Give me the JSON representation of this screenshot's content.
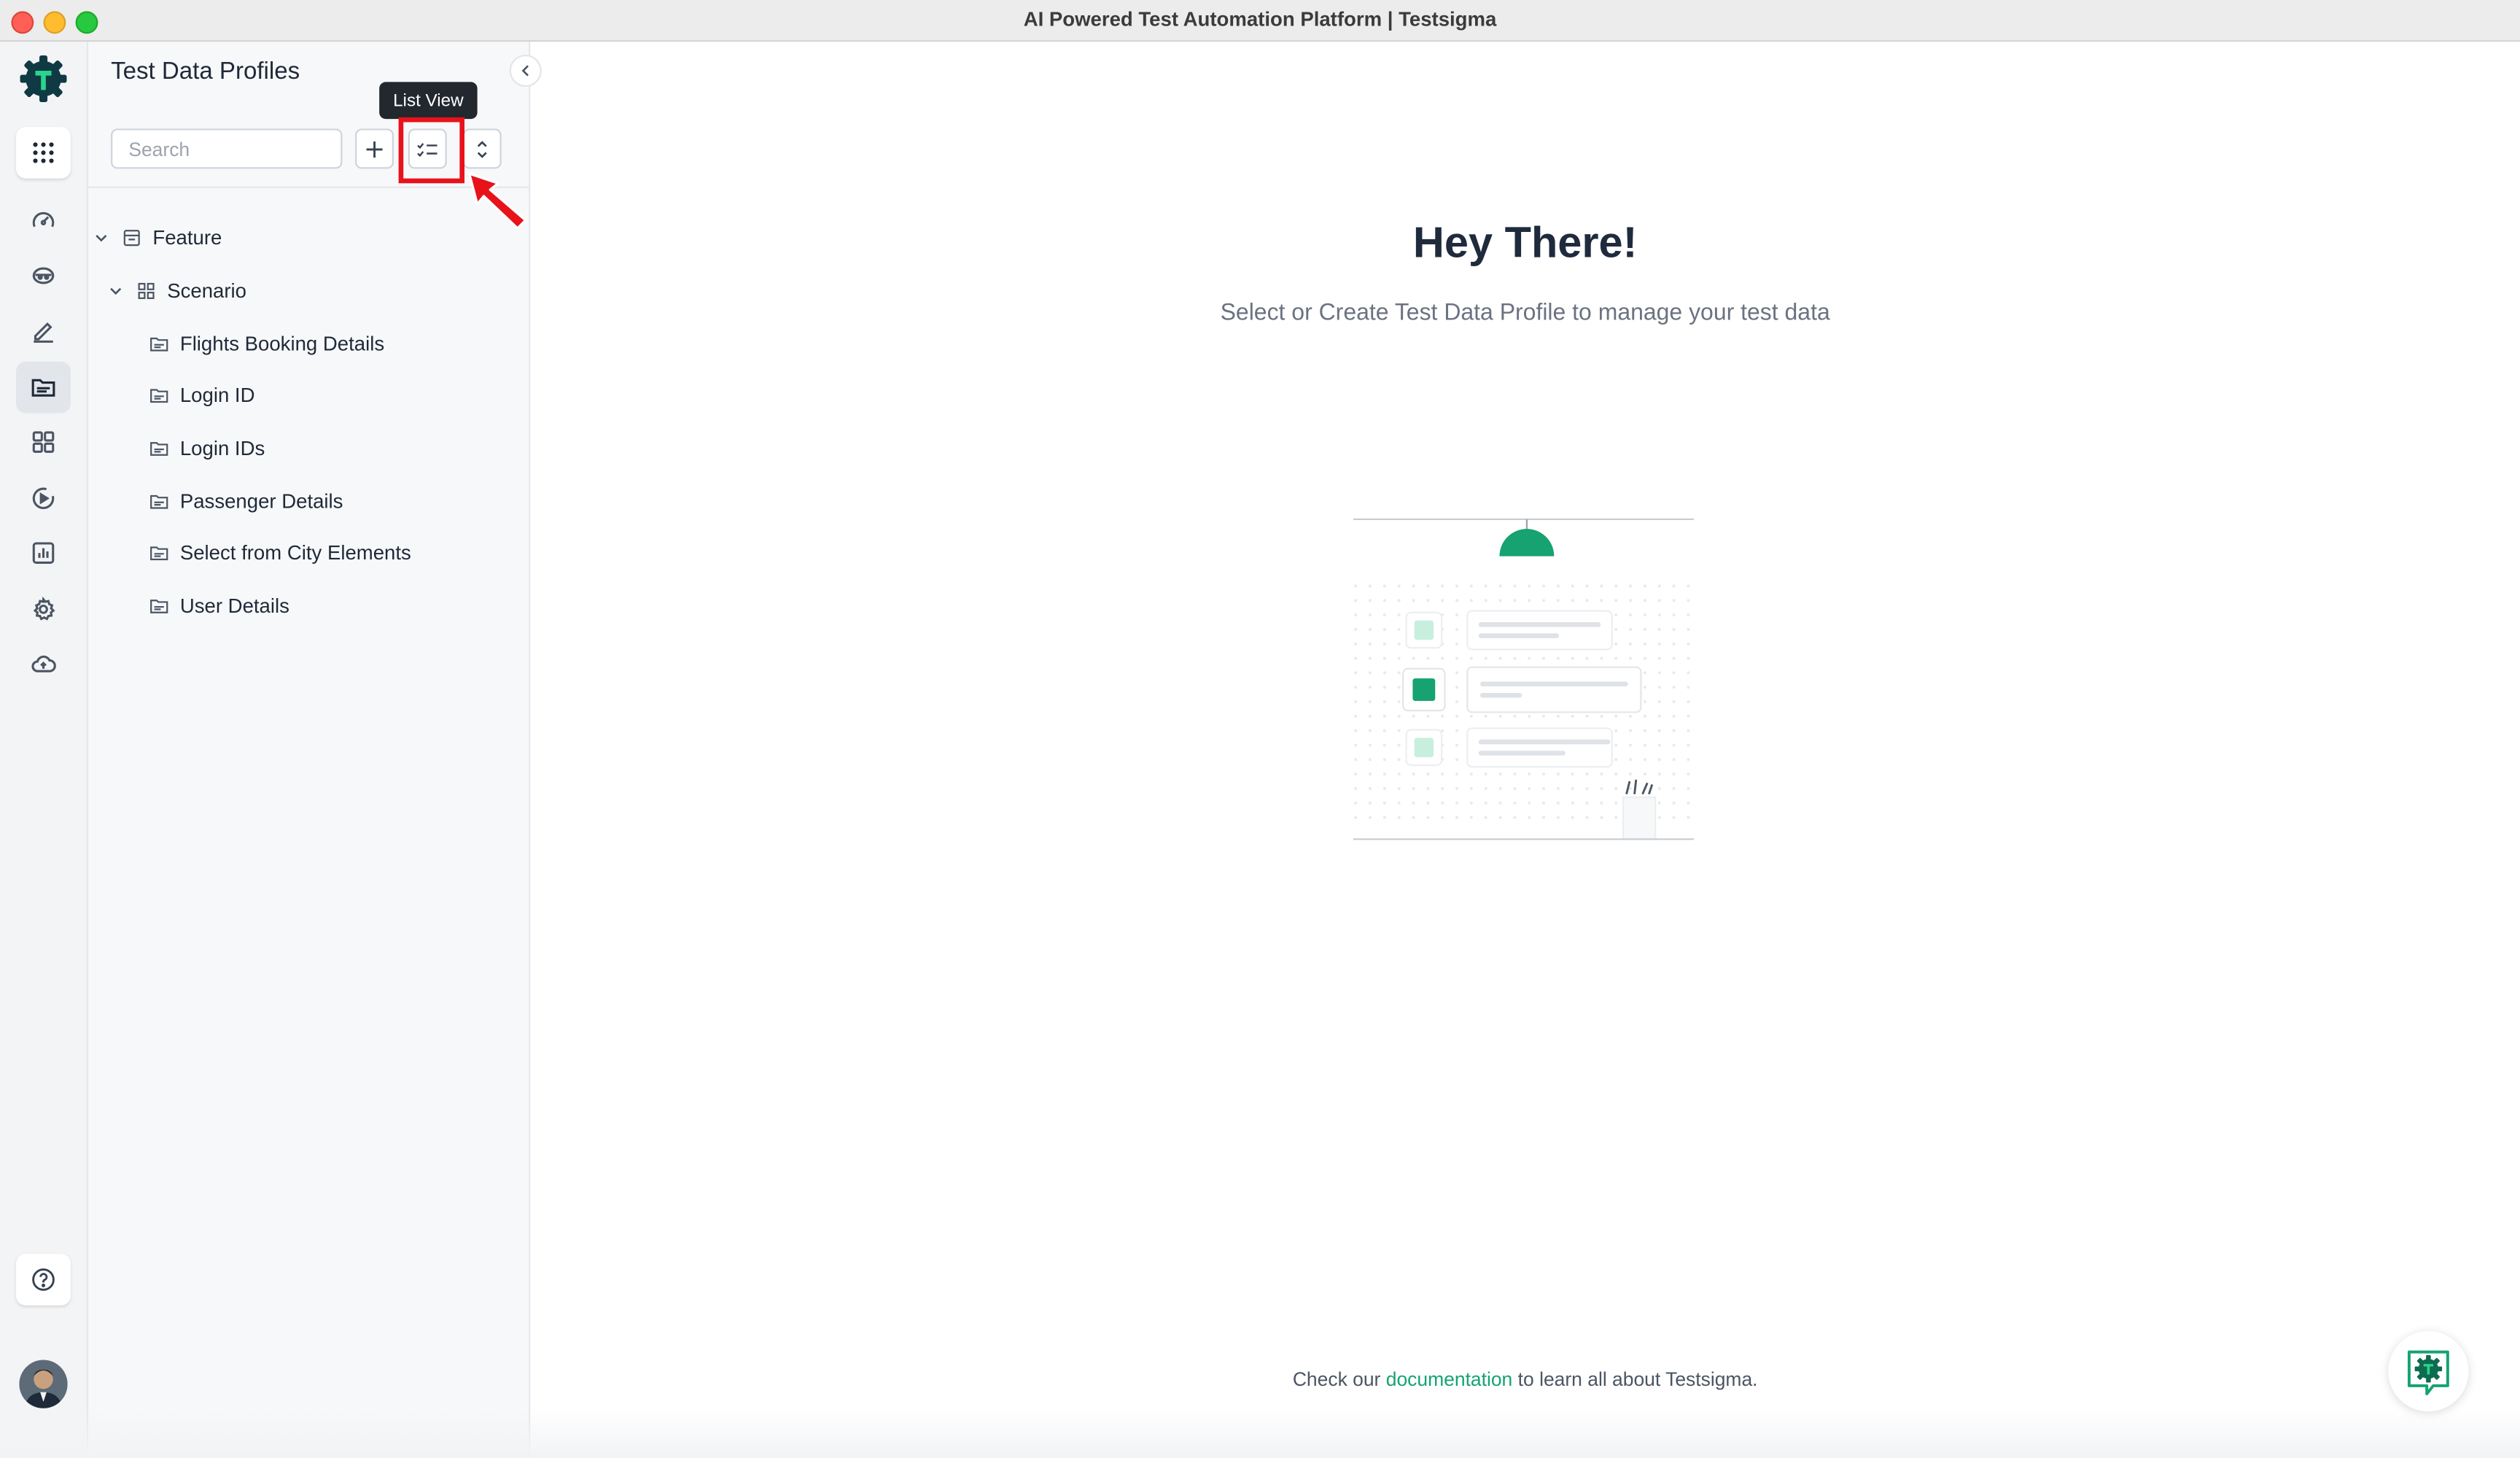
{
  "window": {
    "title": "AI Powered Test Automation Platform | Testsigma"
  },
  "panel": {
    "title": "Test Data Profiles",
    "search_placeholder": "Search",
    "tooltip": "List View"
  },
  "tree": {
    "feature": "Feature",
    "scenario": "Scenario",
    "items": [
      "Flights Booking Details",
      "Login ID",
      "Login IDs",
      "Passenger Details",
      "Select from City Elements",
      "User Details"
    ]
  },
  "main": {
    "heading": "Hey There!",
    "subtext": "Select or Create Test Data Profile to manage your test data",
    "footer_prefix": "Check our",
    "footer_link": "documentation",
    "footer_suffix": "to learn all about Testsigma."
  },
  "colors": {
    "accent": "#16a371",
    "annotation": "#e8121b",
    "logo": "#0f3a44"
  }
}
